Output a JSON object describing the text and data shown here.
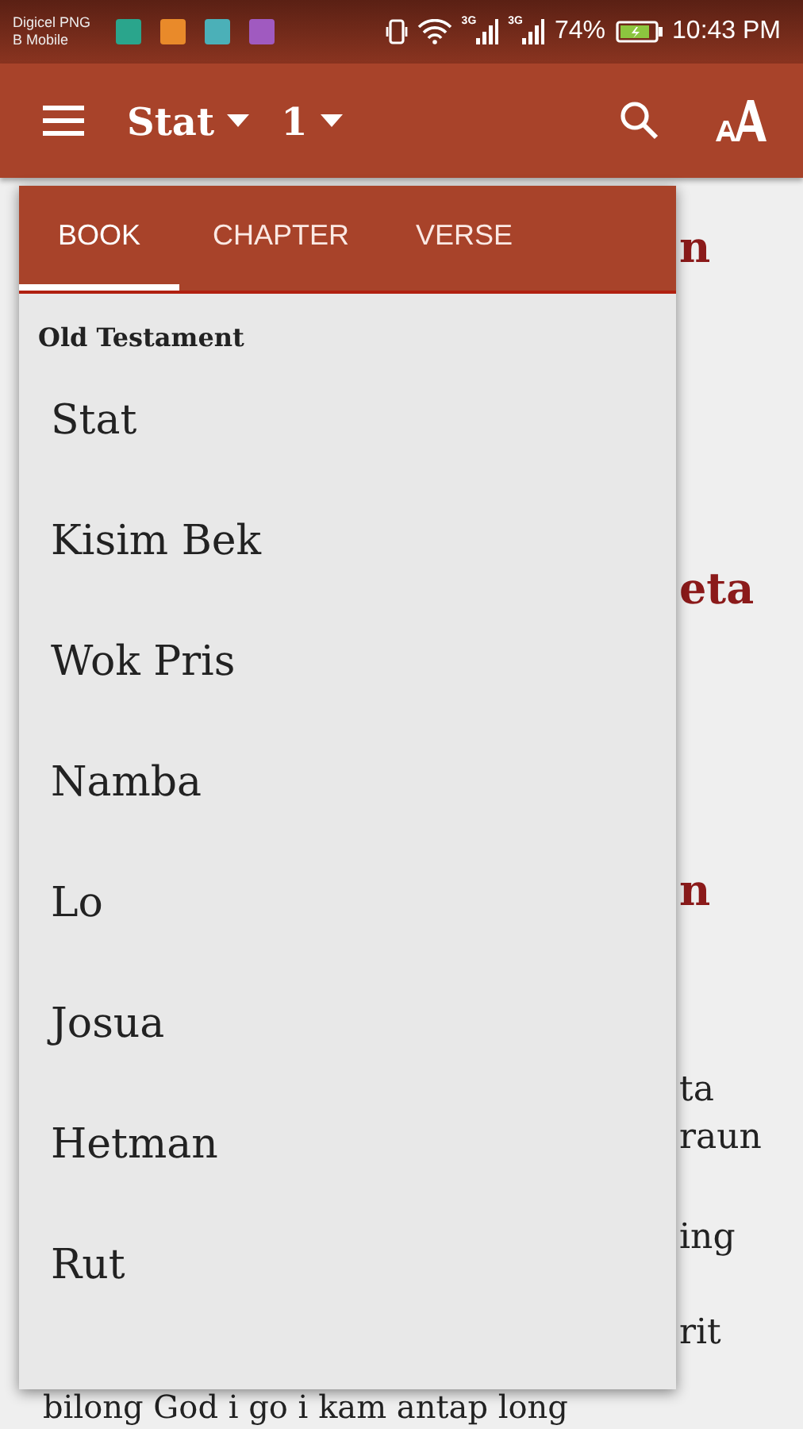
{
  "status_bar": {
    "carrier": [
      "Digicel PNG",
      "B Mobile"
    ],
    "notification_icons": [
      {
        "color": "#2aa58c"
      },
      {
        "color": "#e98a2a"
      },
      {
        "color": "#4bb0b8"
      },
      {
        "color": "#a05ac0"
      }
    ],
    "network_1": "3G",
    "network_2": "3G",
    "battery": "74%",
    "time": "10:43 PM"
  },
  "app_bar": {
    "book": "Stat",
    "chapter": "1"
  },
  "reading_fragments": [
    {
      "kind": "heading",
      "text": "n"
    },
    {
      "kind": "heading",
      "text": "eta"
    },
    {
      "kind": "heading",
      "text": "n"
    },
    {
      "kind": "text",
      "text": "ta"
    },
    {
      "kind": "text",
      "text": "raun"
    },
    {
      "kind": "text",
      "text": "ing"
    },
    {
      "kind": "text",
      "text": "rit"
    }
  ],
  "reading_last_line": "bilong God i go i kam antap long",
  "book_menu": {
    "tabs": [
      {
        "label": "BOOK",
        "selected": true
      },
      {
        "label": "CHAPTER",
        "selected": false
      },
      {
        "label": "VERSE",
        "selected": false
      }
    ],
    "section": "Old Testament",
    "books": [
      "Stat",
      "Kisim Bek",
      "Wok Pris",
      "Namba",
      "Lo",
      "Josua",
      "Hetman",
      "Rut"
    ]
  }
}
